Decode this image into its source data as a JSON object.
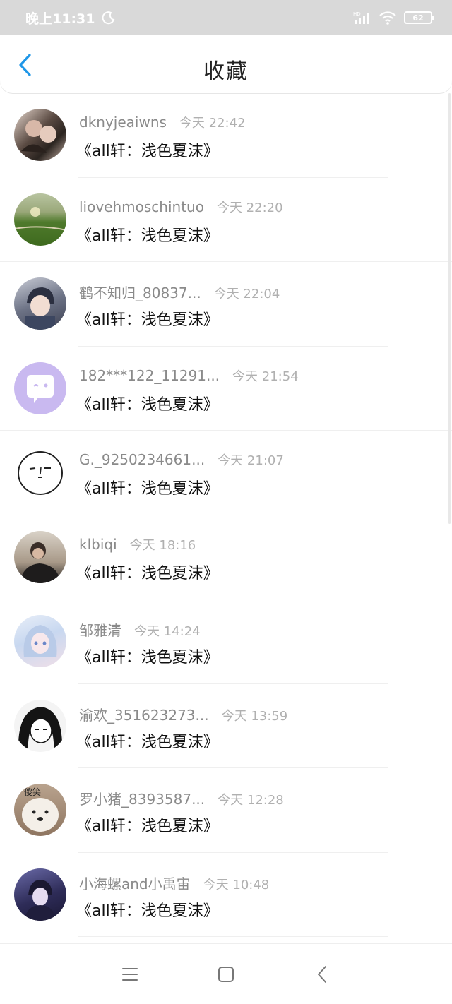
{
  "status_bar": {
    "time": "晚上11:31",
    "battery": "62"
  },
  "header": {
    "title": "收藏"
  },
  "colors": {
    "accent": "#1f97e8",
    "status_bar_bg": "#d9d9d9"
  },
  "items": [
    {
      "name": "dknyjeaiwns",
      "time": "今天 22:42",
      "title": "《all轩：浅色夏沫》",
      "avatar": "photo-couple-avatar"
    },
    {
      "name": "liovehmoschintuo",
      "time": "今天 22:20",
      "title": "《all轩：浅色夏沫》",
      "avatar": "field-sunset-avatar"
    },
    {
      "name": "鹤不知归_80837...",
      "time": "今天 22:04",
      "title": "《all轩：浅色夏沫》",
      "avatar": "anime-boy-avatar"
    },
    {
      "name": "182***122_11291...",
      "time": "今天 21:54",
      "title": "《all轩：浅色夏沫》",
      "avatar": "default-chat-avatar"
    },
    {
      "name": "G._9250234661...",
      "time": "今天 21:07",
      "title": "《all轩：浅色夏沫》",
      "avatar": "sketch-face-avatar"
    },
    {
      "name": "klbiqi",
      "time": "今天 18:16",
      "title": "《all轩：浅色夏沫》",
      "avatar": "person-photo-avatar"
    },
    {
      "name": "邹雅清",
      "time": "今天 14:24",
      "title": "《all轩：浅色夏沫》",
      "avatar": "anime-girl-avatar"
    },
    {
      "name": "渝欢_351623273...",
      "time": "今天 13:59",
      "title": "《all轩：浅色夏沫》",
      "avatar": "manga-girl-avatar"
    },
    {
      "name": "罗小猪_8393587...",
      "time": "今天 12:28",
      "title": "《all轩：浅色夏沫》",
      "avatar": "dog-avatar",
      "avatar_text": "傻笑"
    },
    {
      "name": "小海螺and小禹宙",
      "time": "今天 10:48",
      "title": "《all轩：浅色夏沫》",
      "avatar": "dark-anime-avatar"
    }
  ]
}
